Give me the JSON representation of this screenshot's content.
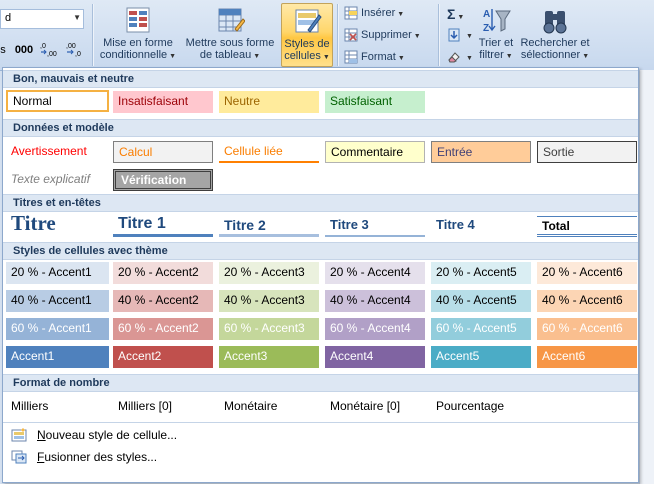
{
  "ribbon": {
    "font_box_value": "d",
    "number_buttons": [
      "s",
      "000",
      ",0→,00",
      ",00→,0"
    ],
    "mise_en_forme": {
      "line1": "Mise en forme",
      "line2": "conditionnelle"
    },
    "mettre_sous_forme": {
      "line1": "Mettre sous forme",
      "line2": "de tableau"
    },
    "styles_cellules": {
      "line1": "Styles de",
      "line2": "cellules"
    },
    "inserer_label": "Insérer",
    "supprimer_label": "Supprimer",
    "format_label": "Format",
    "sigma_symbol": "Σ",
    "trier_filtrer": {
      "line1": "Trier et",
      "line2": "filtrer"
    },
    "rechercher": {
      "line1": "Rechercher et",
      "line2": "sélectionner"
    }
  },
  "gallery": {
    "sections": {
      "bon_mauvais": "Bon, mauvais et neutre",
      "donnees": "Données et modèle",
      "titres": "Titres et en-têtes",
      "theme": "Styles de cellules avec thème",
      "nombre": "Format de nombre"
    },
    "bon_mauvais": {
      "normal": "Normal",
      "insatisfaisant": "Insatisfaisant",
      "neutre": "Neutre",
      "satisfaisant": "Satisfaisant"
    },
    "donnees": {
      "avertissement": "Avertissement",
      "calcul": "Calcul",
      "cellule_liee": "Cellule liée",
      "commentaire": "Commentaire",
      "entree": "Entrée",
      "sortie": "Sortie",
      "texte_explicatif": "Texte explicatif",
      "verification": "Vérification"
    },
    "titres": {
      "titre": "Titre",
      "titre1": "Titre 1",
      "titre2": "Titre 2",
      "titre3": "Titre 3",
      "titre4": "Titre 4",
      "total": "Total"
    },
    "theme_rows": [
      [
        "20 % - Accent1",
        "20 % - Accent2",
        "20 % - Accent3",
        "20 % - Accent4",
        "20 % - Accent5",
        "20 % - Accent6"
      ],
      [
        "40 % - Accent1",
        "40 % - Accent2",
        "40 % - Accent3",
        "40 % - Accent4",
        "40 % - Accent5",
        "40 % - Accent6"
      ],
      [
        "60 % - Accent1",
        "60 % - Accent2",
        "60 % - Accent3",
        "60 % - Accent4",
        "60 % - Accent5",
        "60 % - Accent6"
      ],
      [
        "Accent1",
        "Accent2",
        "Accent3",
        "Accent4",
        "Accent5",
        "Accent6"
      ]
    ],
    "nombre": {
      "milliers": "Milliers",
      "milliers0": "Milliers [0]",
      "monetaire": "Monétaire",
      "monetaire0": "Monétaire [0]",
      "pourcentage": "Pourcentage"
    },
    "menu": {
      "nouveau_underlined": "N",
      "nouveau_rest": "ouveau style de cellule...",
      "fusionner_underlined": "F",
      "fusionner_rest": "usionner des styles..."
    }
  },
  "colors": {
    "accent1": "#4f81bd",
    "accent2": "#c0504d",
    "accent3": "#9bbb59",
    "accent4": "#8064a2",
    "accent5": "#4bacc6",
    "accent6": "#f79646",
    "insatisfaisant_bg": "#ffc7ce",
    "neutre_bg": "#ffeb9c",
    "satisfaisant_bg": "#c6efce",
    "selected_highlight": "#ffc743"
  }
}
